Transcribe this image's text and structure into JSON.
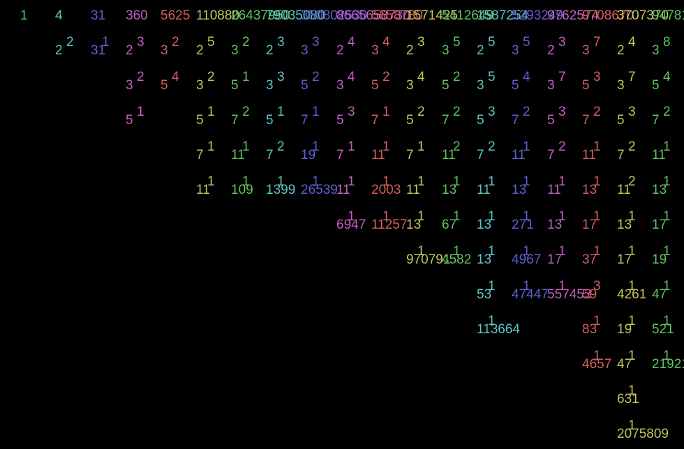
{
  "colors": [
    "#5fc45f",
    "#5fc4c4",
    "#5f5fd4",
    "#c45fc4",
    "#d45f5f",
    "#c4c45f"
  ],
  "columns": [
    {
      "value": "1",
      "factors": []
    },
    {
      "value": "4",
      "factors": [
        {
          "base": "2",
          "exp": "2"
        }
      ]
    },
    {
      "value": "31",
      "factors": [
        {
          "base": "31",
          "exp": "1"
        }
      ]
    },
    {
      "value": "360",
      "factors": [
        {
          "base": "2",
          "exp": "3"
        },
        {
          "base": "3",
          "exp": "2"
        },
        {
          "base": "5",
          "exp": "1"
        }
      ]
    },
    {
      "value": "5625",
      "factors": [
        {
          "base": "3",
          "exp": "2"
        },
        {
          "base": "5",
          "exp": "4"
        }
      ]
    },
    {
      "value": "110880",
      "factors": [
        {
          "base": "2",
          "exp": "5"
        },
        {
          "base": "3",
          "exp": "2"
        },
        {
          "base": "5",
          "exp": "1"
        },
        {
          "base": "7",
          "exp": "1"
        },
        {
          "base": "11",
          "exp": "1"
        }
      ]
    },
    {
      "value": "26437950",
      "factors": [
        {
          "base": "3",
          "exp": "2"
        },
        {
          "base": "5",
          "exp": "1"
        },
        {
          "base": "7",
          "exp": "2"
        },
        {
          "base": "11",
          "exp": "1"
        },
        {
          "base": "109",
          "exp": "1"
        }
      ]
    },
    {
      "value": "79035080",
      "factors": [
        {
          "base": "2",
          "exp": "3"
        },
        {
          "base": "3",
          "exp": "3"
        },
        {
          "base": "5",
          "exp": "1"
        },
        {
          "base": "7",
          "exp": "2"
        },
        {
          "base": "1399",
          "exp": "1"
        }
      ]
    },
    {
      "value": "350802530",
      "factors": [
        {
          "base": "3",
          "exp": "3"
        },
        {
          "base": "5",
          "exp": "2"
        },
        {
          "base": "7",
          "exp": "1"
        },
        {
          "base": "19",
          "exp": "1"
        },
        {
          "base": "26539",
          "exp": "1"
        }
      ]
    },
    {
      "value": "8665658730",
      "factors": [
        {
          "base": "2",
          "exp": "4"
        },
        {
          "base": "3",
          "exp": "4"
        },
        {
          "base": "5",
          "exp": "3"
        },
        {
          "base": "7",
          "exp": "1"
        },
        {
          "base": "11",
          "exp": "1"
        },
        {
          "base": "6947",
          "exp": "1"
        }
      ]
    },
    {
      "value": "5658730",
      "factors": [
        {
          "base": "3",
          "exp": "4"
        },
        {
          "base": "5",
          "exp": "2"
        },
        {
          "base": "7",
          "exp": "1"
        },
        {
          "base": "11",
          "exp": "1"
        },
        {
          "base": "2003",
          "exp": "1"
        },
        {
          "base": "11257",
          "exp": "1"
        }
      ]
    },
    {
      "value": "1571425",
      "factors": [
        {
          "base": "2",
          "exp": "3"
        },
        {
          "base": "3",
          "exp": "4"
        },
        {
          "base": "5",
          "exp": "2"
        },
        {
          "base": "7",
          "exp": "1"
        },
        {
          "base": "11",
          "exp": "1"
        },
        {
          "base": "13",
          "exp": "1"
        },
        {
          "base": "970791",
          "exp": "1"
        }
      ]
    },
    {
      "value": "5412649",
      "factors": [
        {
          "base": "3",
          "exp": "5"
        },
        {
          "base": "5",
          "exp": "2"
        },
        {
          "base": "7",
          "exp": "2"
        },
        {
          "base": "11",
          "exp": "2"
        },
        {
          "base": "13",
          "exp": "1"
        },
        {
          "base": "67",
          "exp": "1"
        },
        {
          "base": "4582",
          "exp": "1"
        }
      ]
    },
    {
      "value": "1587254",
      "factors": [
        {
          "base": "2",
          "exp": "5"
        },
        {
          "base": "3",
          "exp": "5"
        },
        {
          "base": "5",
          "exp": "3"
        },
        {
          "base": "7",
          "exp": "2"
        },
        {
          "base": "11",
          "exp": "1"
        },
        {
          "base": "13",
          "exp": "1"
        },
        {
          "base": "13",
          "exp": "1"
        },
        {
          "base": "53",
          "exp": "1"
        },
        {
          "base": "113664",
          "exp": "1"
        }
      ]
    },
    {
      "value": "5293249",
      "factors": [
        {
          "base": "3",
          "exp": "5"
        },
        {
          "base": "5",
          "exp": "4"
        },
        {
          "base": "7",
          "exp": "2"
        },
        {
          "base": "11",
          "exp": "1"
        },
        {
          "base": "13",
          "exp": "1"
        },
        {
          "base": "271",
          "exp": "1"
        },
        {
          "base": "4967",
          "exp": "1"
        },
        {
          "base": "47447",
          "exp": "1"
        }
      ]
    },
    {
      "value": "9762574",
      "factors": [
        {
          "base": "2",
          "exp": "3"
        },
        {
          "base": "3",
          "exp": "7"
        },
        {
          "base": "5",
          "exp": "3"
        },
        {
          "base": "7",
          "exp": "2"
        },
        {
          "base": "11",
          "exp": "1"
        },
        {
          "base": "13",
          "exp": "1"
        },
        {
          "base": "17",
          "exp": "1"
        },
        {
          "base": "557453",
          "exp": "1"
        }
      ]
    },
    {
      "value": "9708670",
      "factors": [
        {
          "base": "3",
          "exp": "7"
        },
        {
          "base": "5",
          "exp": "3"
        },
        {
          "base": "7",
          "exp": "2"
        },
        {
          "base": "11",
          "exp": "1"
        },
        {
          "base": "13",
          "exp": "1"
        },
        {
          "base": "17",
          "exp": "1"
        },
        {
          "base": "37",
          "exp": "1"
        },
        {
          "base": "59",
          "exp": "3"
        },
        {
          "base": "83",
          "exp": "1"
        },
        {
          "base": "4657",
          "exp": "1"
        }
      ]
    },
    {
      "value": "3707370",
      "factors": [
        {
          "base": "2",
          "exp": "4"
        },
        {
          "base": "3",
          "exp": "7"
        },
        {
          "base": "5",
          "exp": "3"
        },
        {
          "base": "7",
          "exp": "2"
        },
        {
          "base": "11",
          "exp": "2"
        },
        {
          "base": "13",
          "exp": "1"
        },
        {
          "base": "17",
          "exp": "1"
        },
        {
          "base": "4261",
          "exp": "1"
        },
        {
          "base": "19",
          "exp": "1"
        },
        {
          "base": "47",
          "exp": "1"
        },
        {
          "base": "631",
          "exp": "1"
        },
        {
          "base": "2075809",
          "exp": "1"
        }
      ]
    },
    {
      "value": "94781",
      "factors": [
        {
          "base": "3",
          "exp": "8"
        },
        {
          "base": "5",
          "exp": "4"
        },
        {
          "base": "7",
          "exp": "2"
        },
        {
          "base": "11",
          "exp": "1"
        },
        {
          "base": "13",
          "exp": "1"
        },
        {
          "base": "17",
          "exp": "1"
        },
        {
          "base": "19",
          "exp": "1"
        },
        {
          "base": "47",
          "exp": "1"
        },
        {
          "base": "521",
          "exp": "1"
        },
        {
          "base": "21921",
          "exp": "1"
        }
      ]
    }
  ]
}
